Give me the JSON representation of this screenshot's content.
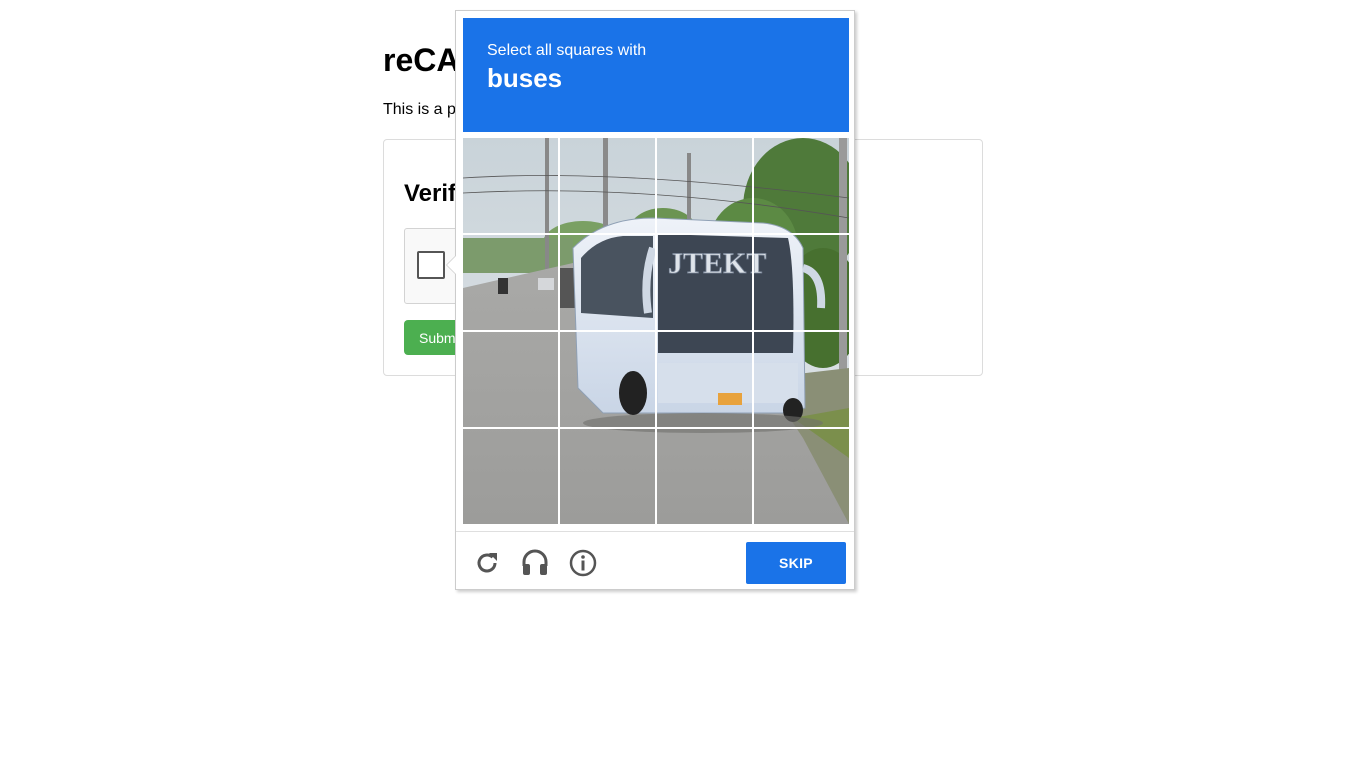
{
  "page": {
    "title": "reCA",
    "intro": "This is a p"
  },
  "demo": {
    "heading": "Verif",
    "submit_label": "Submi"
  },
  "challenge": {
    "instruction": "Select all squares with",
    "target": "buses",
    "bus_livery_text": "JTEKT",
    "tiles": [
      "r1c1",
      "r1c2",
      "r1c3",
      "r1c4",
      "r2c1",
      "r2c2",
      "r2c3",
      "r2c4",
      "r3c1",
      "r3c2",
      "r3c3",
      "r3c4",
      "r4c1",
      "r4c2",
      "r4c3",
      "r4c4"
    ],
    "footer": {
      "skip_label": "SKIP",
      "icons": [
        "reload-icon",
        "audio-icon",
        "info-icon"
      ]
    }
  },
  "colors": {
    "header_blue": "#1a73e8",
    "submit_green": "#4caf50"
  }
}
